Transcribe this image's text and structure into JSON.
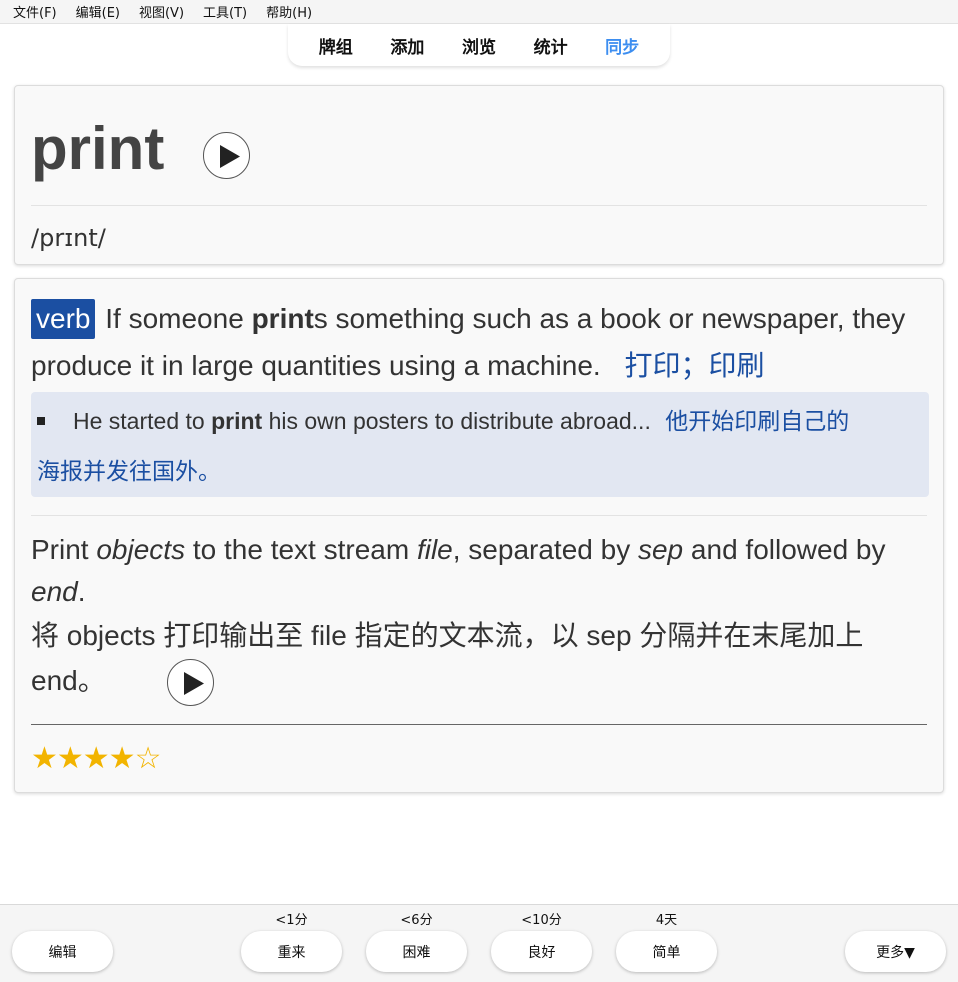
{
  "menu": [
    "文件(F)",
    "编辑(E)",
    "视图(V)",
    "工具(T)",
    "帮助(H)"
  ],
  "tabs": [
    "牌组",
    "添加",
    "浏览",
    "统计",
    "同步"
  ],
  "card_front": {
    "word": "print",
    "phonetic": "/prɪnt/"
  },
  "definition": {
    "pos": "verb",
    "text_before": "If someone ",
    "bold_word": "print",
    "text_after": "s something such as a book or newspaper, they produce it in large quantities using a machine.",
    "translation": "打印；印刷"
  },
  "example": {
    "text_before": "He started to ",
    "bold_word": "print",
    "text_after": " his own posters to distribute abroad...",
    "translation_1": "他开始印刷自己的",
    "translation_2": "海报并发往国外。"
  },
  "note": {
    "p1": "Print ",
    "i1": "objects",
    "p2": " to the text stream ",
    "i2": "file",
    "p3": ", separated by ",
    "i3": "sep",
    "p4": " and followed by ",
    "i4": "end",
    "p5": ".",
    "zh": "将 objects 打印输出至 file 指定的文本流，以 sep 分隔并在末尾加上 end。"
  },
  "rating": {
    "stars": 4,
    "max": 5,
    "text": "★★★★☆"
  },
  "bottom": {
    "edit": "编辑",
    "more": "更多▼",
    "answers": [
      {
        "label": "重来",
        "due": "<1分"
      },
      {
        "label": "困难",
        "due": "<6分"
      },
      {
        "label": "良好",
        "due": "<10分"
      },
      {
        "label": "简单",
        "due": "4天"
      }
    ]
  }
}
